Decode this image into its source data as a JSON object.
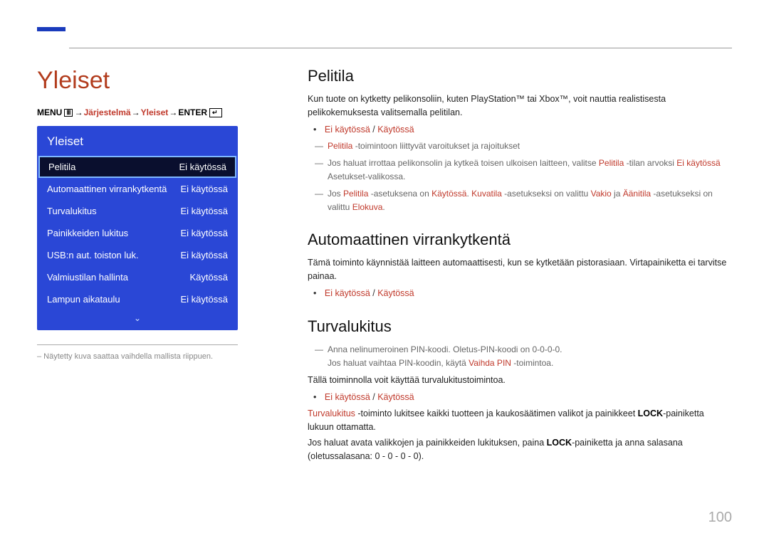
{
  "page_number": "100",
  "left": {
    "chapter_title": "Yleiset",
    "breadcrumb": {
      "prefix": "MENU",
      "arrow": "→",
      "seg1": "Järjestelmä",
      "seg2": "Yleiset",
      "suffix": "ENTER"
    },
    "menu": {
      "title": "Yleiset",
      "items": [
        {
          "label": "Pelitila",
          "value": "Ei käytössä",
          "selected": true
        },
        {
          "label": "Automaattinen virrankytkentä",
          "value": "Ei käytössä"
        },
        {
          "label": "Turvalukitus",
          "value": "Ei käytössä"
        },
        {
          "label": "Painikkeiden lukitus",
          "value": "Ei käytössä"
        },
        {
          "label": "USB:n aut. toiston luk.",
          "value": "Ei käytössä"
        },
        {
          "label": "Valmiustilan hallinta",
          "value": "Käytössä"
        },
        {
          "label": "Lampun aikataulu",
          "value": "Ei käytössä"
        }
      ]
    },
    "caption": "– Näytetty kuva saattaa vaihdella mallista riippuen."
  },
  "right": {
    "s1": {
      "heading": "Pelitila",
      "intro": "Kun tuote on kytketty pelikonsoliin, kuten PlayStation™ tai Xbox™, voit nauttia realistisesta pelikokemuksesta valitsemalla pelitilan.",
      "option_off": "Ei käytössä",
      "option_slash": " / ",
      "option_on": "Käytössä",
      "note1_a": "Pelitila",
      "note1_b": " -toimintoon liittyvät varoitukset ja rajoitukset",
      "note2_a": "Jos haluat irrottaa pelikonsolin ja kytkeä toisen ulkoisen laitteen, valitse ",
      "note2_b": "Pelitila",
      "note2_c": " -tilan arvoksi ",
      "note2_d": "Ei käytössä",
      "note2_e": " Asetukset-valikossa.",
      "note3_a": "Jos ",
      "note3_b": "Pelitila",
      "note3_c": " -asetuksena on ",
      "note3_d": "Käytössä",
      "note3_e": ". ",
      "note3_f": "Kuvatila",
      "note3_g": " -asetukseksi on valittu ",
      "note3_h": "Vakio",
      "note3_i": " ja ",
      "note3_j": "Äänitila",
      "note3_k": " -asetukseksi on valittu ",
      "note3_l": "Elokuva",
      "note3_m": "."
    },
    "s2": {
      "heading": "Automaattinen virrankytkentä",
      "intro": "Tämä toiminto käynnistää laitteen automaattisesti, kun se kytketään pistorasiaan. Virtapainiketta ei tarvitse painaa.",
      "option_off": "Ei käytössä",
      "option_slash": " / ",
      "option_on": "Käytössä"
    },
    "s3": {
      "heading": "Turvalukitus",
      "note1_a": "Anna nelinumeroinen PIN-koodi. Oletus-PIN-koodi on 0-0-0-0.",
      "note1_b": "Jos haluat vaihtaa PIN-koodin, käytä ",
      "note1_c": "Vaihda PIN",
      "note1_d": " -toimintoa.",
      "p1": "Tällä toiminnolla voit käyttää turvalukitustoimintoa.",
      "option_off": "Ei käytössä",
      "option_slash": " / ",
      "option_on": "Käytössä",
      "p2_a": "Turvalukitus",
      "p2_b": " -toiminto lukitsee kaikki tuotteen ja kaukosäätimen valikot ja painikkeet ",
      "p2_c": "LOCK",
      "p2_d": "-painiketta lukuun ottamatta.",
      "p3_a": "Jos haluat avata valikkojen ja painikkeiden lukituksen, paina ",
      "p3_b": "LOCK",
      "p3_c": "-painiketta ja anna salasana (oletussalasana: 0 - 0 - 0 - 0)."
    }
  }
}
